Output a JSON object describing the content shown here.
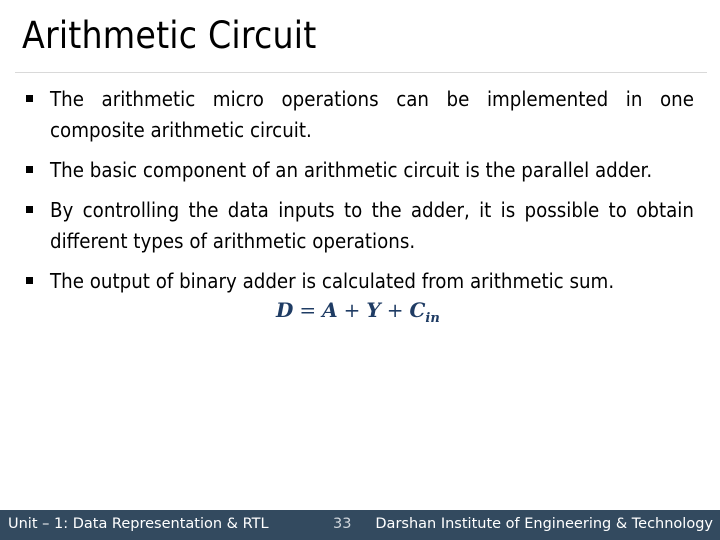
{
  "slide": {
    "title": "Arithmetic Circuit",
    "bullets": [
      "The arithmetic micro operations can be implemented in one composite arithmetic circuit.",
      "The basic component of an arithmetic circuit is the parallel adder.",
      "By controlling the data inputs to the adder, it is possible to obtain different types of arithmetic operations.",
      "The output of binary adder is calculated from arithmetic sum."
    ],
    "formula": {
      "lhs": "D",
      "equals": "=",
      "term1": "A",
      "plus1": "+",
      "term2": "Y",
      "plus2": "+",
      "term3": "C",
      "term3_sub": "in"
    }
  },
  "footer": {
    "unit": "Unit – 1: Data Representation & RTL",
    "page_number": "33",
    "institute": "Darshan Institute of Engineering & Technology"
  },
  "colors": {
    "footer_bg": "#334a5f",
    "formula": "#1f3c64"
  }
}
